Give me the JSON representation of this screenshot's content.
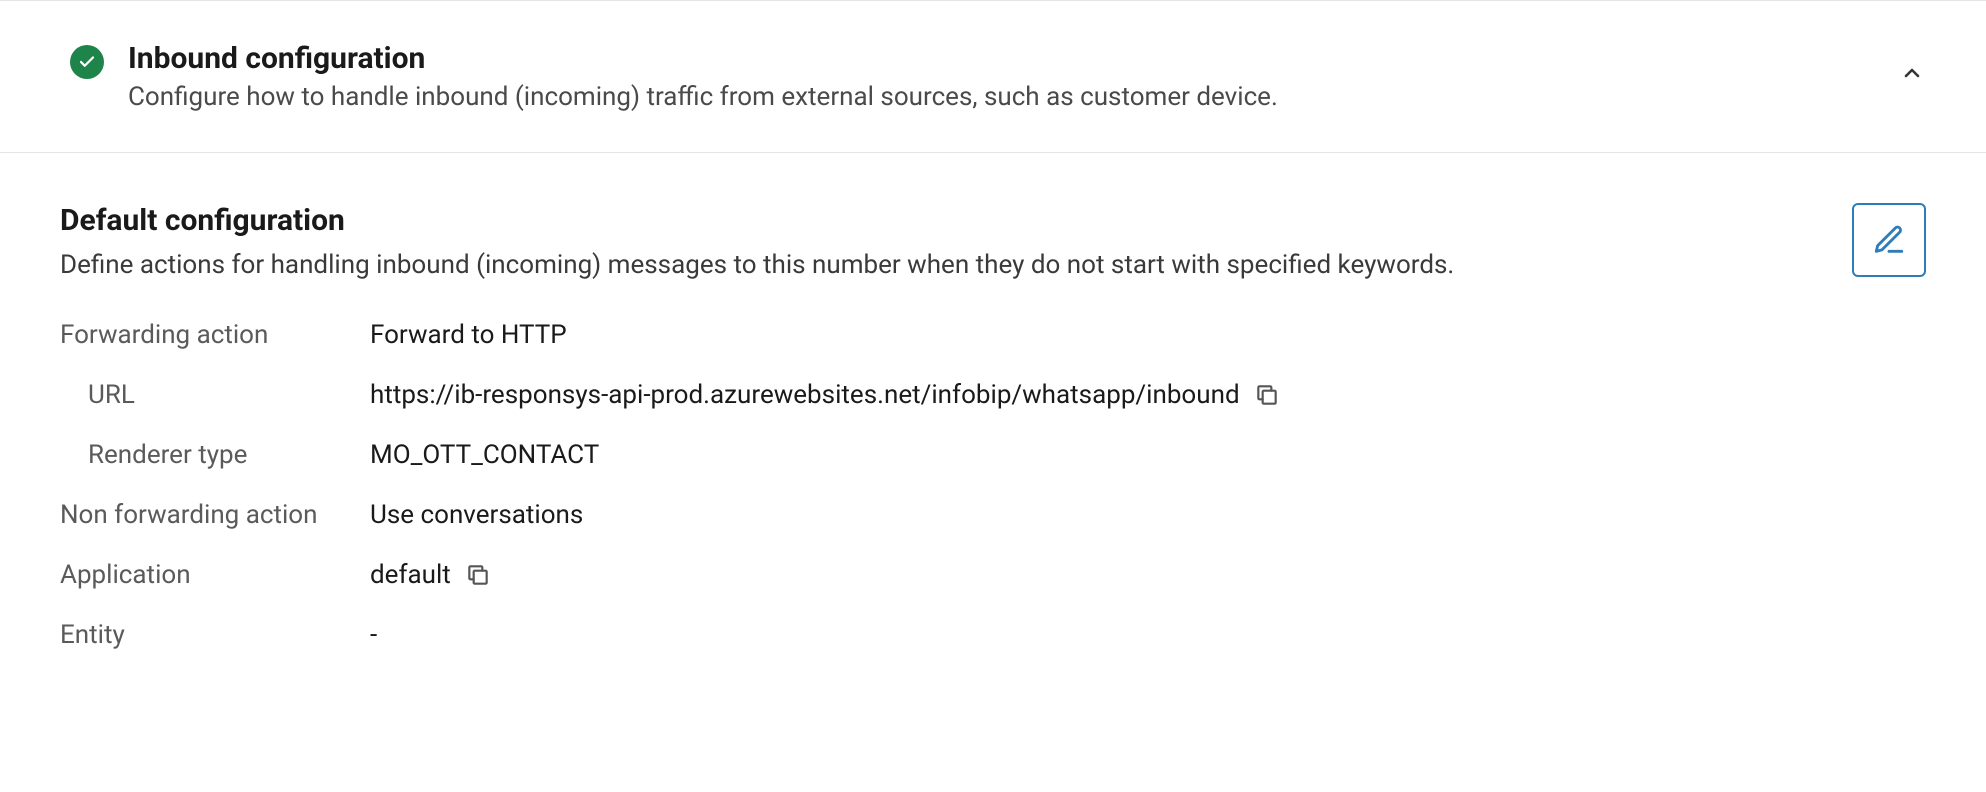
{
  "header": {
    "title": "Inbound configuration",
    "description": "Configure how to handle inbound (incoming) traffic from external sources, such as customer device."
  },
  "section": {
    "title": "Default configuration",
    "description": "Define actions for handling inbound (incoming) messages to this number when they do not start with specified keywords."
  },
  "fields": {
    "forwarding_action_label": "Forwarding action",
    "forwarding_action_value": "Forward to HTTP",
    "url_label": "URL",
    "url_value": "https://ib-responsys-api-prod.azurewebsites.net/infobip/whatsapp/inbound",
    "renderer_type_label": "Renderer type",
    "renderer_type_value": "MO_OTT_CONTACT",
    "non_forwarding_action_label": "Non forwarding action",
    "non_forwarding_action_value": "Use conversations",
    "application_label": "Application",
    "application_value": "default",
    "entity_label": "Entity",
    "entity_value": "-"
  }
}
